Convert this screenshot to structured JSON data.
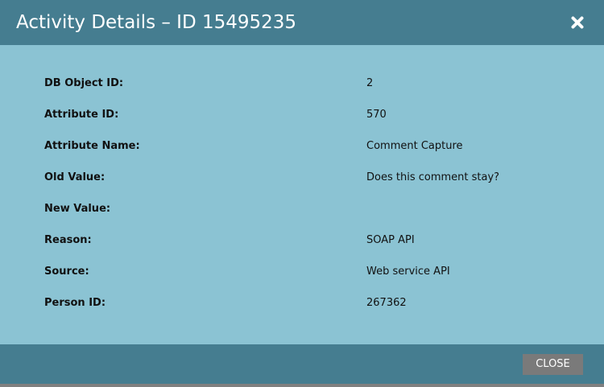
{
  "dialog": {
    "title": "Activity Details – ID 15495235",
    "close_icon": "close-icon",
    "close_label": "CLOSE",
    "colors": {
      "header": "#457d90",
      "body": "#8bc3d3",
      "button": "#7a7a7a"
    }
  },
  "details": [
    {
      "label": "DB Object ID:",
      "value": "2"
    },
    {
      "label": "Attribute ID:",
      "value": "570"
    },
    {
      "label": "Attribute Name:",
      "value": "Comment Capture"
    },
    {
      "label": "Old Value:",
      "value": "Does this comment stay?"
    },
    {
      "label": "New Value:",
      "value": ""
    },
    {
      "label": "Reason:",
      "value": "SOAP API"
    },
    {
      "label": "Source:",
      "value": "Web service API"
    },
    {
      "label": "Person ID:",
      "value": "267362"
    }
  ]
}
